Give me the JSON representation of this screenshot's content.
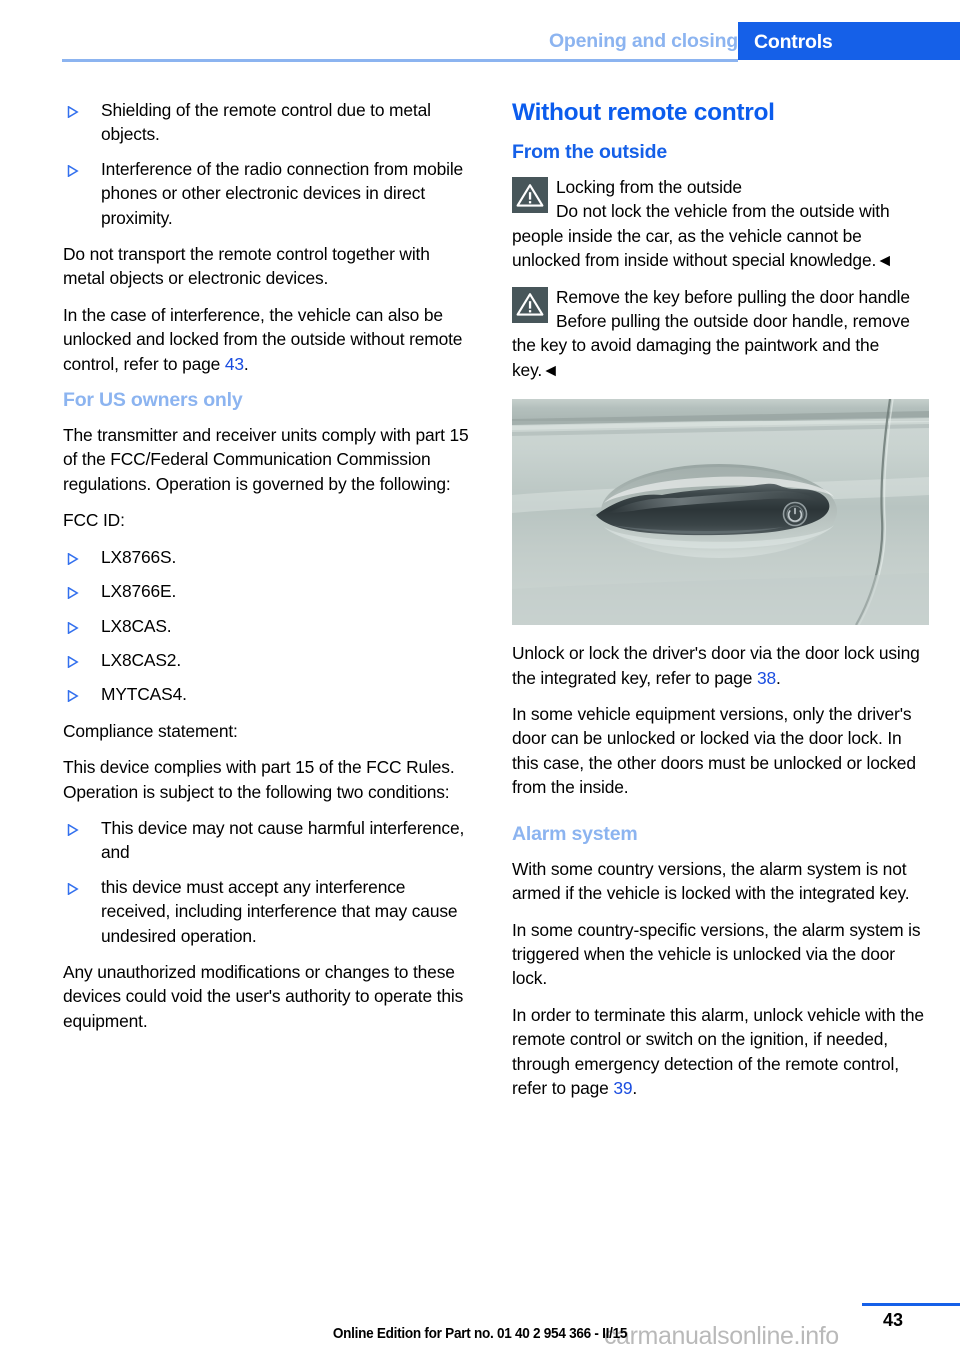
{
  "header": {
    "chapter": "Opening and closing",
    "section": "Controls",
    "chapter_color": "#8cb4f0",
    "section_bg": "#1560e8",
    "section_color": "#ffffff",
    "rule_color": "#8cb4f0"
  },
  "left_column": {
    "bullets_top": [
      "Shielding of the remote control due to metal objects.",
      "Interference of the radio connection from mobile phones or other electronic devices in direct proximity."
    ],
    "para_transport": "Do not transport the remote control together with metal objects or electronic devices.",
    "para_interference_pre": "In the case of interference, the vehicle can also be unlocked and locked from the outside without remote control, refer to page ",
    "para_interference_ref": "43",
    "para_interference_post": ".",
    "heading_us_owners": "For US owners only",
    "para_transmitter": "The transmitter and receiver units comply with part 15 of the FCC/Federal Communication Commission regulations. Operation is governed by the following:",
    "label_fcc_id": "FCC ID:",
    "fcc_ids": [
      "LX8766S.",
      "LX8766E.",
      "LX8CAS.",
      "LX8CAS2.",
      "MYTCAS4."
    ],
    "label_compliance": "Compliance statement:",
    "para_complies": "This device complies with part 15 of the FCC Rules. Operation is subject to the following two conditions:",
    "conditions": [
      "This device may not cause harmful interference, and",
      "this device must accept any interference received, including interference that may cause undesired operation."
    ],
    "para_unauthorized": "Any unauthorized modifications or changes to these devices could void the user's authority to operate this equipment."
  },
  "right_column": {
    "heading_main": "Without remote control",
    "heading_from_outside": "From the outside",
    "warning_1": {
      "icon": "warning-triangle-icon",
      "title": "Locking from the outside",
      "body": "Do not lock the vehicle from the outside with people inside the car, as the vehicle cannot be unlocked from inside without special knowledge.◄"
    },
    "warning_2": {
      "icon": "warning-triangle-icon",
      "title": "Remove the key before pulling the door handle",
      "body": "Before pulling the outside door handle, remove the key to avoid damaging the paintwork and the key.◄"
    },
    "photo": {
      "name": "car-door-handle-photo",
      "alt": "Exterior car door with door handle and integrated key lock cylinder"
    },
    "para_unlock_pre": "Unlock or lock the driver's door via the door lock using the integrated key, refer to page ",
    "para_unlock_ref": "38",
    "para_unlock_post": ".",
    "para_equipment": "In some vehicle equipment versions, only the driver's door can be unlocked or locked via the door lock. In this case, the other doors must be unlocked or locked from the inside.",
    "heading_alarm": "Alarm system",
    "para_alarm_1": "With some country versions, the alarm system is not armed if the vehicle is locked with the integrated key.",
    "para_alarm_2": "In some country-specific versions, the alarm system is triggered when the vehicle is unlocked via the door lock.",
    "para_alarm_3_pre": "In order to terminate this alarm, unlock vehicle with the remote control or switch on the ignition, if needed, through emergency detection of the remote control, refer to page ",
    "para_alarm_3_ref": "39",
    "para_alarm_3_post": "."
  },
  "footer": {
    "edition": "Online Edition for Part no. 01 40 2 954 366 - II/15",
    "page_number": "43",
    "watermark": "carmanualsonline.info",
    "rule_color": "#1560e8"
  }
}
